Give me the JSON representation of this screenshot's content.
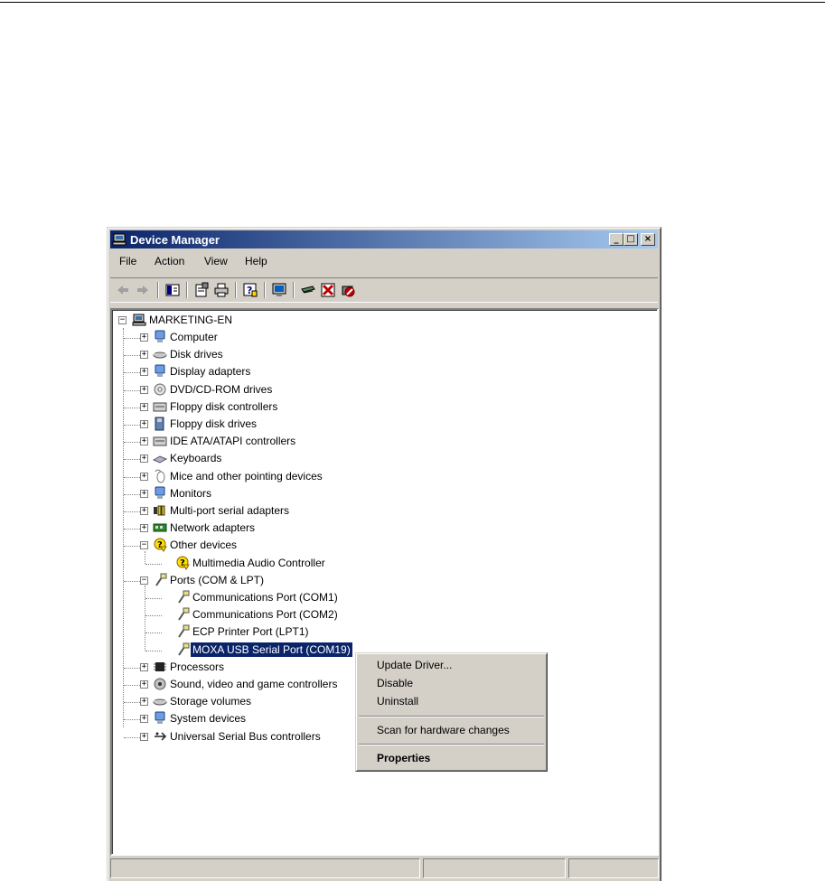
{
  "window": {
    "title": "Device Manager",
    "controls": {
      "minimize": "_",
      "maximize": "□",
      "close": "×"
    }
  },
  "menubar": {
    "items": [
      "File",
      "Action",
      "View",
      "Help"
    ]
  },
  "toolbar": {
    "icons": [
      "back-icon",
      "forward-icon",
      "show-hide-tree-icon",
      "properties-icon",
      "print-icon",
      "help-icon",
      "update-driver-icon",
      "scan-hardware-icon",
      "uninstall-icon",
      "disable-icon"
    ]
  },
  "tree": {
    "root": "MARKETING-EN",
    "items": [
      "Computer",
      "Disk drives",
      "Display adapters",
      "DVD/CD-ROM drives",
      "Floppy disk controllers",
      "Floppy disk drives",
      "IDE ATA/ATAPI controllers",
      "Keyboards",
      "Mice and other pointing devices",
      "Monitors",
      "Multi-port serial adapters",
      "Network adapters",
      "Other devices",
      "Multimedia Audio Controller",
      "Ports (COM & LPT)",
      "Communications Port (COM1)",
      "Communications Port (COM2)",
      "ECP Printer Port (LPT1)",
      "MOXA USB Serial Port (COM19)",
      "Processors",
      "Sound, video and game controllers",
      "Storage volumes",
      "System devices",
      "Universal Serial Bus controllers"
    ],
    "expander_collapsed": "+",
    "expander_expanded": "−"
  },
  "context_menu": {
    "update_driver": "Update Driver...",
    "disable": "Disable",
    "uninstall": "Uninstall",
    "scan": "Scan for hardware changes",
    "properties": "Properties"
  },
  "colors": {
    "selection": "#0a246a",
    "face": "#d4d0c8",
    "title_gradient_start": "#0a246a",
    "title_gradient_end": "#a6caf0"
  }
}
